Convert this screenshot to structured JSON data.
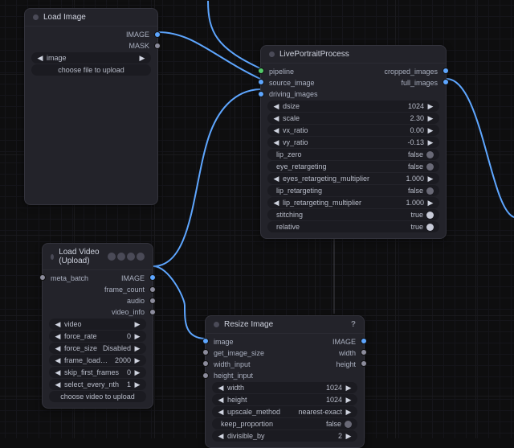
{
  "nodes": {
    "load_image": {
      "title": "Load Image",
      "outputs": {
        "image": "IMAGE",
        "mask": "MASK"
      },
      "widgets": {
        "image": {
          "label": "image"
        },
        "upload": "choose file to upload"
      }
    },
    "live_portrait": {
      "title": "LivePortraitProcess",
      "inputs": {
        "pipeline": "pipeline",
        "source_image": "source_image",
        "driving_images": "driving_images"
      },
      "outputs": {
        "cropped": "cropped_images",
        "full": "full_images"
      },
      "widgets": {
        "dsize": {
          "label": "dsize",
          "value": "1024"
        },
        "scale": {
          "label": "scale",
          "value": "2.30"
        },
        "vx_ratio": {
          "label": "vx_ratio",
          "value": "0.00"
        },
        "vy_ratio": {
          "label": "vy_ratio",
          "value": "-0.13"
        },
        "lip_zero": {
          "label": "lip_zero",
          "value": "false",
          "bool": false
        },
        "eye_retargeting": {
          "label": "eye_retargeting",
          "value": "false",
          "bool": false
        },
        "eyes_multiplier": {
          "label": "eyes_retargeting_multiplier",
          "value": "1.000"
        },
        "lip_retargeting": {
          "label": "lip_retargeting",
          "value": "false",
          "bool": false
        },
        "lip_multiplier": {
          "label": "lip_retargeting_multiplier",
          "value": "1.000"
        },
        "stitching": {
          "label": "stitching",
          "value": "true",
          "bool": true
        },
        "relative": {
          "label": "relative",
          "value": "true",
          "bool": true
        }
      }
    },
    "load_video": {
      "title": "Load Video (Upload)",
      "inputs": {
        "meta_batch": "meta_batch"
      },
      "outputs": {
        "image": "IMAGE",
        "frame_count": "frame_count",
        "audio": "audio",
        "video_info": "video_info"
      },
      "widgets": {
        "video": {
          "label": "video"
        },
        "force_rate": {
          "label": "force_rate",
          "value": "0"
        },
        "force_size": {
          "label": "force_size",
          "value": "Disabled"
        },
        "frame_load_cap": {
          "label": "frame_load_cap",
          "value": "2000"
        },
        "skip_first_frames": {
          "label": "skip_first_frames",
          "value": "0"
        },
        "select_every_nth": {
          "label": "select_every_nth",
          "value": "1"
        },
        "upload": "choose video to upload"
      }
    },
    "resize_image": {
      "title": "Resize Image",
      "help": "?",
      "inputs": {
        "image": "image",
        "get_image_size": "get_image_size",
        "width_input": "width_input",
        "height_input": "height_input"
      },
      "outputs": {
        "image": "IMAGE",
        "width": "width",
        "height": "height"
      },
      "widgets": {
        "width": {
          "label": "width",
          "value": "1024"
        },
        "height": {
          "label": "height",
          "value": "1024"
        },
        "upscale_method": {
          "label": "upscale_method",
          "value": "nearest-exact"
        },
        "keep_proportion": {
          "label": "keep_proportion",
          "value": "false",
          "bool": false
        },
        "divisible_by": {
          "label": "divisible_by",
          "value": "2"
        }
      }
    }
  }
}
